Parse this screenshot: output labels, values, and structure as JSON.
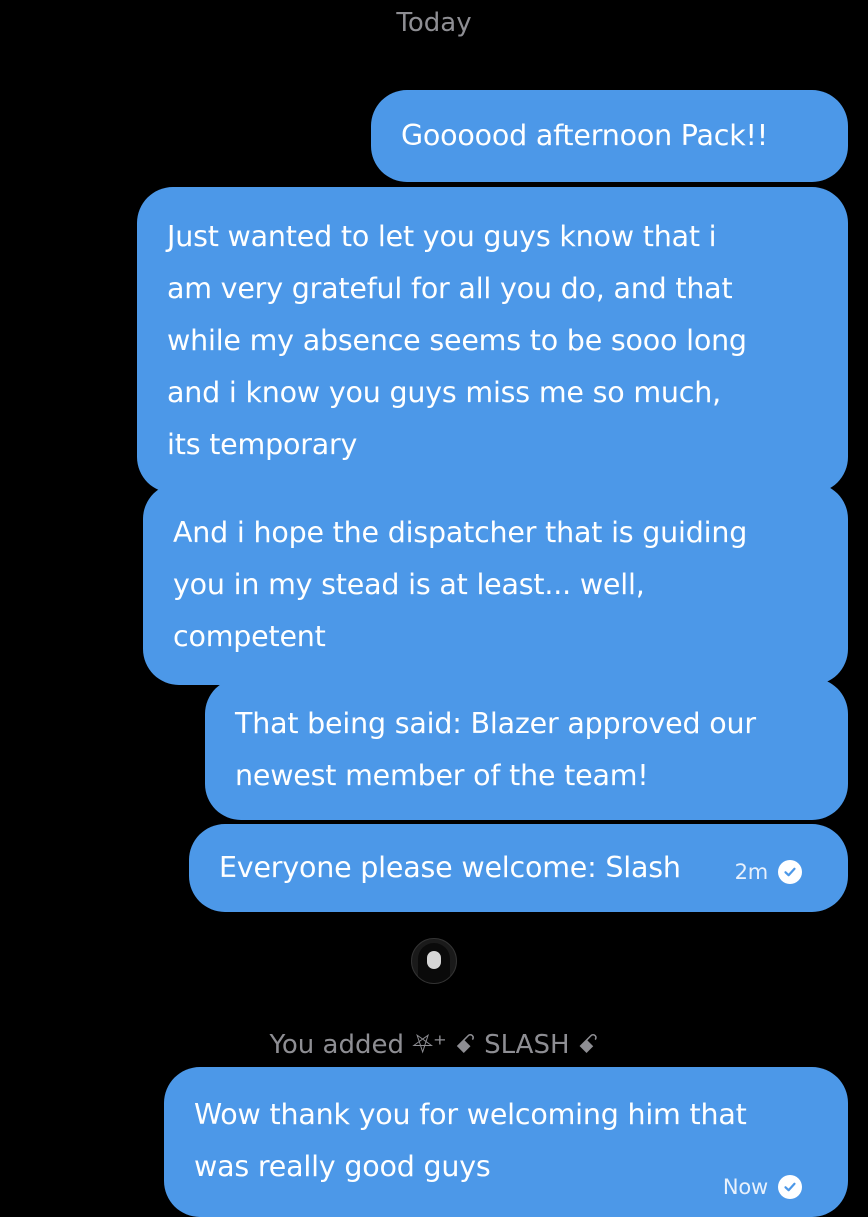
{
  "conversation": {
    "day_label": "Today"
  },
  "messages": [
    {
      "lines": [
        "Goooood afternoon Pack!!"
      ]
    },
    {
      "lines": [
        "Just wanted to let you guys know that i",
        "am very grateful for all you do, and that",
        "while my absence seems to be sooo long",
        "and i know you guys miss me so much,",
        "its temporary"
      ]
    },
    {
      "lines": [
        "And i hope the dispatcher that is guiding",
        "you in my stead is at least... well,",
        "competent"
      ]
    },
    {
      "lines": [
        "That being said: Blazer approved our",
        "newest member of the team!"
      ]
    },
    {
      "lines": [
        "Everyone please welcome: Slash"
      ],
      "time": "2m"
    },
    {
      "lines": [
        "Wow thank you for welcoming him that",
        "was really good guys"
      ],
      "time": "Now"
    }
  ],
  "system_event": {
    "prefix": "You added",
    "user_name": "⛧⁺ ꗃ SLASH ꗃ"
  },
  "colors": {
    "background": "#000000",
    "bubble": "#4c98e8",
    "muted_text": "#8e8e93",
    "bubble_text": "#ffffff"
  },
  "icons": {
    "read_receipt": "check-circle-icon",
    "avatar": "user-avatar"
  }
}
